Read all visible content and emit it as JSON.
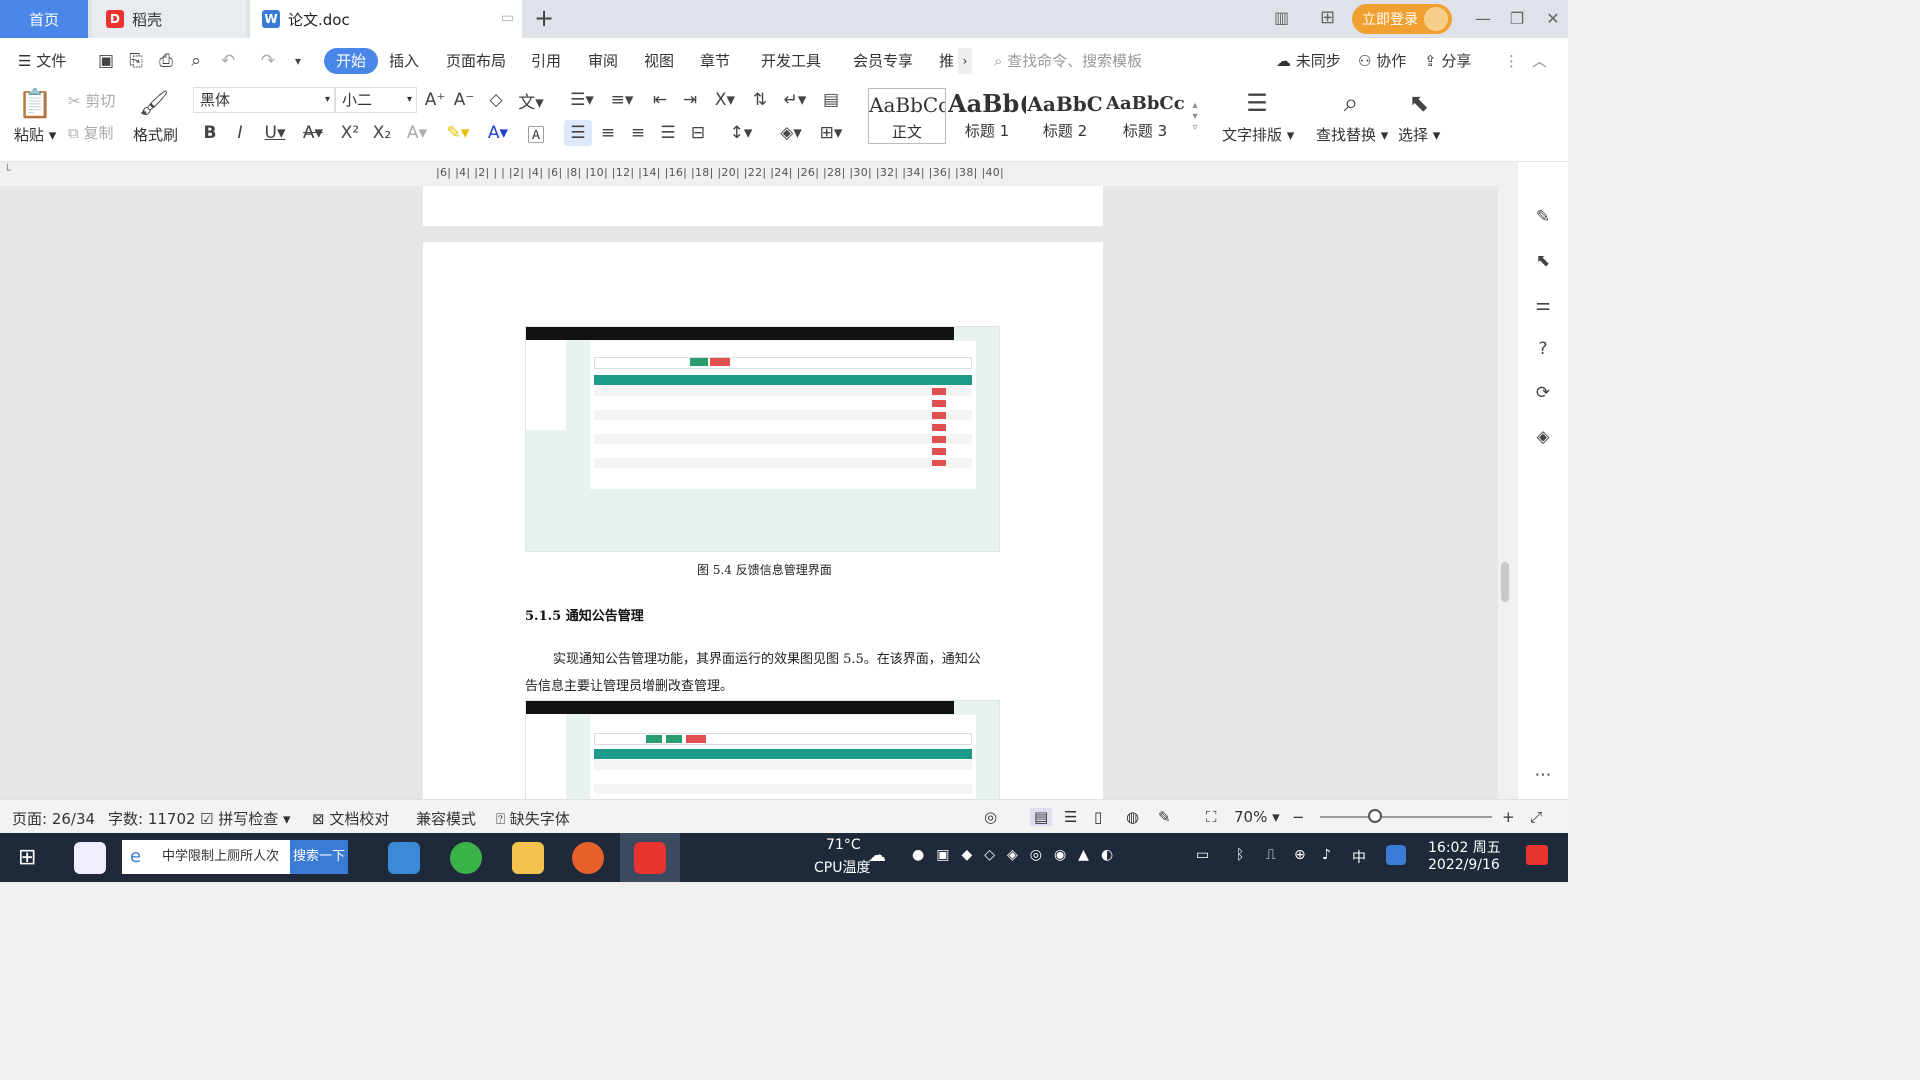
{
  "tabs": {
    "home": "首页",
    "daoke": "稻壳",
    "doc": "论文.doc",
    "add": "+"
  },
  "titlebar": {
    "login": "立即登录"
  },
  "menu": {
    "file": "文件",
    "items": [
      "开始",
      "插入",
      "页面布局",
      "引用",
      "审阅",
      "视图",
      "章节",
      "开发工具",
      "会员专享",
      "推"
    ],
    "search_placeholder": "查找命令、搜索模板",
    "sync": "未同步",
    "collab": "协作",
    "share": "分享"
  },
  "ribbon": {
    "paste": "粘贴",
    "cut": "剪切",
    "copy": "复制",
    "format_painter": "格式刷",
    "font_name": "黑体",
    "font_size": "小二",
    "styles": [
      {
        "preview": "AaBbCcI",
        "name": "正文"
      },
      {
        "preview": "AaBb(",
        "name": "标题 1"
      },
      {
        "preview": "AaBbC",
        "name": "标题 2"
      },
      {
        "preview": "AaBbCcl",
        "name": "标题 3"
      }
    ],
    "text_layout": "文字排版",
    "find_replace": "查找替换",
    "select": "选择"
  },
  "ruler": "|6| |4| |2| | | |2| |4| |6| |8| |10| |12| |14| |16| |18| |20| |22| |24| |26| |28| |30| |32| |34| |36| |38| |40|",
  "document": {
    "figure_caption": "图 5.4  反馈信息管理界面",
    "section_title": "5.1.5  通知公告管理",
    "paragraph_line1": "实现通知公告管理功能，其界面运行的效果图见图 5.5。在该界面，通知公",
    "paragraph_line2": "告信息主要让管理员增删改查管理。"
  },
  "statusbar": {
    "page": "页面: 26/34",
    "words": "字数: 11702",
    "spellcheck": "拼写检查",
    "proofread": "文档校对",
    "compat": "兼容模式",
    "missing_font": "缺失字体",
    "zoom": "70%"
  },
  "taskbar": {
    "ie_search_text": "中学限制上厕所人次",
    "ie_search_button": "搜索一下",
    "temperature": "71°C",
    "cpu_label": "CPU温度",
    "ime": "中",
    "time": "16:02 周五",
    "date": "2022/9/16"
  }
}
